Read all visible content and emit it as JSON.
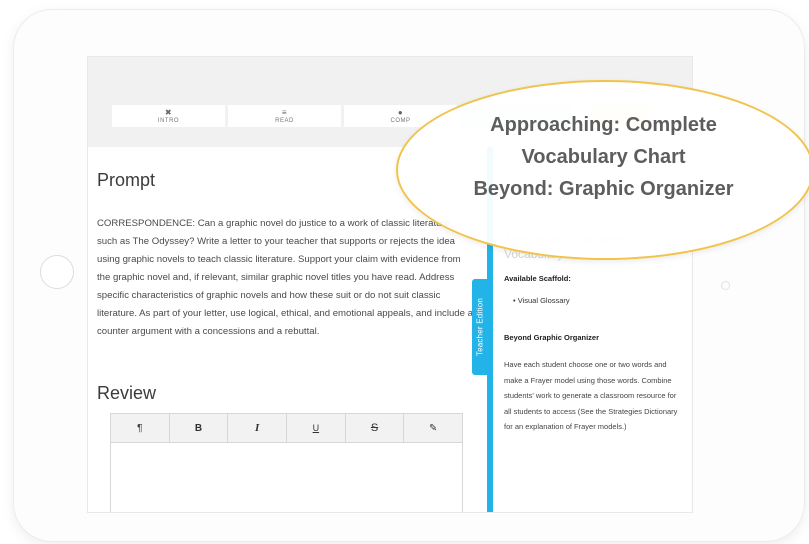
{
  "tabs": [
    {
      "icon": "✖",
      "label": "INTRO"
    },
    {
      "icon": "≡",
      "label": "READ"
    },
    {
      "icon": "●",
      "label": "COMP"
    },
    {
      "icon": "",
      "label": ""
    },
    {
      "icon": "",
      "label": ""
    }
  ],
  "prompt": {
    "title": "Prompt",
    "text": "CORRESPONDENCE: Can a graphic novel do justice to a work of classic literature, such as The Odyssey? Write a letter to your teacher that supports or rejects the idea using graphic novels to teach classic literature. Support your claim with evidence from the graphic novel and, if relevant, similar graphic novel titles you have read. Address specific characteristics of graphic novels and how these suit or do not suit classic literature. As part of your letter, use logical, ethical, and emotional appeals, and include a counter argument with a concessions and a rebuttal."
  },
  "review": {
    "title": "Review",
    "toolbar": [
      {
        "name": "paragraph-button",
        "glyph": "¶",
        "style": ""
      },
      {
        "name": "bold-button",
        "glyph": "B",
        "style": "bold"
      },
      {
        "name": "italic-button",
        "glyph": "I",
        "style": "italic"
      },
      {
        "name": "underline-button",
        "glyph": "U",
        "style": "underline"
      },
      {
        "name": "strikethrough-button",
        "glyph": "S",
        "style": "strike"
      },
      {
        "name": "pencil-button",
        "glyph": "✎",
        "style": ""
      }
    ]
  },
  "teacher_edition": {
    "tab_label": "Teacher Edition",
    "faded_heading": "Approaching Complete Vocabulary Chart",
    "available_label": "Available Scaffold:",
    "scaffold_items": [
      "Visual Glossary"
    ],
    "beyond_label": "Beyond Graphic Organizer",
    "beyond_text": "Have each student choose one or two words and make a Frayer model using those words. Combine students' work to generate a classroom resource for all students to access (See the Strategies Dictionary for an explanation of Frayer models.)"
  },
  "callout": {
    "lines": [
      "Approaching: Complete",
      "Vocabulary Chart",
      "Beyond: Graphic Organizer"
    ]
  },
  "colors": {
    "accent_blue": "#22b3e8",
    "callout_border": "#f0c44c",
    "tab_orange": "#fde0bf"
  }
}
